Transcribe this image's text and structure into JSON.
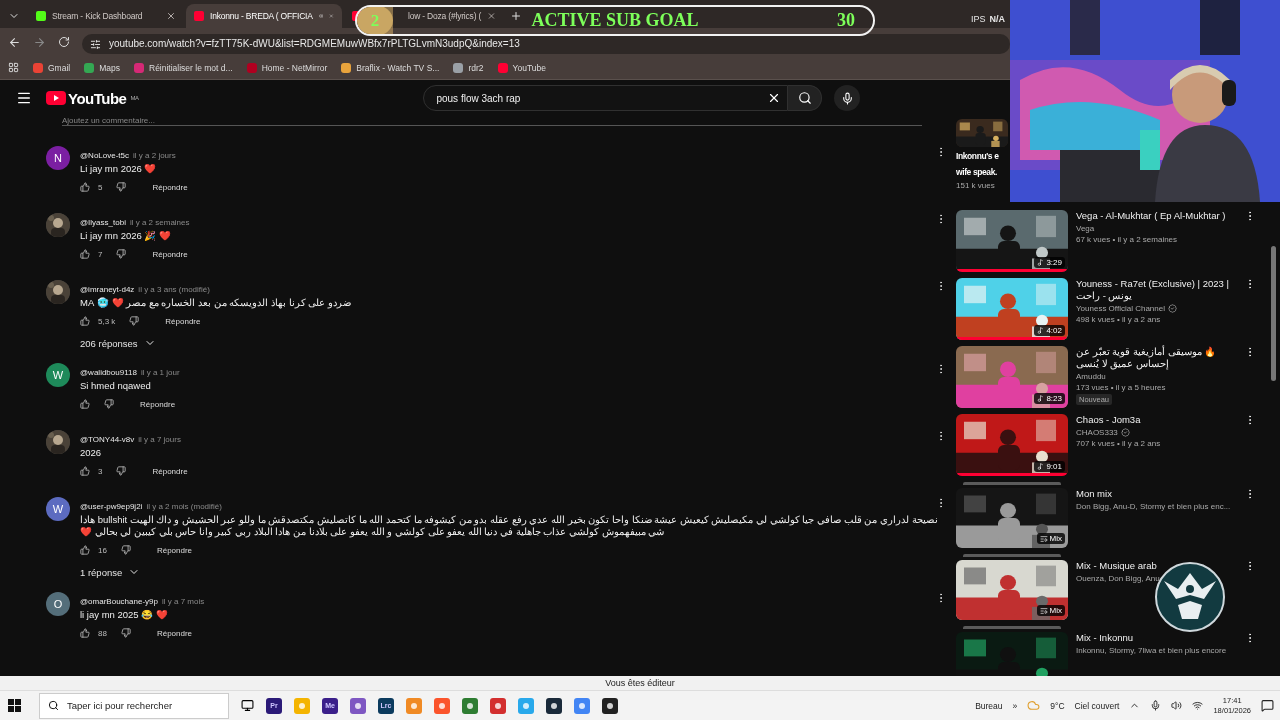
{
  "browser": {
    "tabs": [
      {
        "title": "Stream - Kick Dashboard",
        "selected": false,
        "audio": false,
        "color": "#53fc18"
      },
      {
        "title": "Inkonnu - BREDA ( OFFICIA",
        "selected": true,
        "audio": true,
        "color": "#ff0033"
      },
      {
        "title": "low - Doza (#lyrics) (",
        "selected": false,
        "audio": false,
        "color": "#ff0033"
      }
    ],
    "ips": {
      "label": "IPS",
      "value": "N/A"
    },
    "url": "youtube.com/watch?v=fzTT75K-dWU&list=RDGMEMuwWBfx7rPLTGLvmN3udpQ&index=13",
    "bookmarks": [
      {
        "label": "Gmail",
        "color": "#ea4335"
      },
      {
        "label": "Maps",
        "color": "#34a853"
      },
      {
        "label": "Réinitialiser le mot d...",
        "color": "#d62976"
      },
      {
        "label": "Home - NetMirror",
        "color": "#b00020"
      },
      {
        "label": "Braflix - Watch TV S...",
        "color": "#e8a33c"
      },
      {
        "label": "rdr2",
        "color": "#9aa0a6"
      },
      {
        "label": "YouTube",
        "color": "#ff0033"
      }
    ]
  },
  "sub_goal": {
    "current": "2",
    "title": "ACTIVE SUB GOAL",
    "target": "30",
    "level": 0.07
  },
  "youtube": {
    "logo": "YouTube",
    "region": "MA",
    "search": "pous flow 3ach rap"
  },
  "comment_box": {
    "placeholder": "Ajoutez un commentaire..."
  },
  "comments": [
    {
      "author": "@NoLove-t5c",
      "time": "il y a 2 jours",
      "text": "Li jay mn 2026 ❤️",
      "likes": "5",
      "reply": "Répondre",
      "avatar": {
        "kind": "letter",
        "letter": "N",
        "color": "#7b1fa2"
      }
    },
    {
      "author": "@Ilyass_tobi",
      "time": "il y a 2 semaines",
      "text": "Li jay mn 2026 🎉 ❤️",
      "likes": "7",
      "reply": "Répondre"
    },
    {
      "author": "@imraneyt-d4z",
      "time": "il y a 3 ans (modifié)",
      "text": "ضردو على كرنا بهاذ الدويسكه من بعد الخساره مع مصر ❤️ 🥶 MA",
      "likes": "5,3 k",
      "reply": "Répondre",
      "replies": "206 réponses"
    },
    {
      "author": "@walidbou9118",
      "time": "il y a 1 jour",
      "text": "Si hmed nqawed",
      "reply": "Répondre",
      "avatar": {
        "kind": "letter",
        "letter": "W",
        "color": "#1e8a5a"
      }
    },
    {
      "author": "@TONY44-v8v",
      "time": "il y a 7 jours",
      "text": "2026",
      "likes": "3",
      "reply": "Répondre"
    },
    {
      "author": "@user-pw9ep9j2i",
      "time": "il y a 2 mois (modifié)",
      "text": "نصيحة لدراري من قلب صافي جيا كولشي لي مكيصليش كيعيش عيشة ضنكا واحا تكون بخير الله عدي رفع عقله بدو من كيشوفه ما كتحمد الله ما كاتصليش مكتصدقش ما وللو عبر الحشيش و داك الهيت bullshit هادا شي مبيفهموش كولشي عذاب جاهلية في دنيا الله يعفو على كولشي و الله يعفو على بلادنا من هادا البلاد ربي كبير وانا حاس بلي كيبين لي بحالي ❤️",
      "likes": "16",
      "reply": "Répondre",
      "replies": "1 réponse",
      "avatar": {
        "kind": "letter",
        "letter": "W",
        "color": "#5c6bc0"
      }
    },
    {
      "author": "@omarBouchane-y9p",
      "time": "il y a 7 mois",
      "text": "li jay mn 2025 😂 ❤️",
      "likes": "88",
      "reply": "Répondre",
      "avatar": {
        "kind": "letter",
        "letter": "O",
        "color": "#546e7a"
      }
    }
  ],
  "related": [
    {
      "kind": "partial",
      "title_lines": [
        "Inkonnu's e",
        "wife speak."
      ],
      "meta": "151 k vues"
    },
    {
      "kind": "video",
      "title": "Vega - Al-Mukhtar ( Ep Al-Mukhtar )",
      "channel": "Vega",
      "verified": false,
      "meta": "67 k vues • il y a 2 semaines",
      "duration": "3:29",
      "watched": true
    },
    {
      "kind": "video",
      "title": "Youness  - Ra7et (Exclusive) | 2023 | يونس - راحت",
      "channel": "Youness Official Channel",
      "verified": true,
      "meta": "498 k vues • il y a 2 ans",
      "duration": "4:02",
      "watched": true
    },
    {
      "kind": "video",
      "title": "🔥 موسيقى أمازيغية قوية تعبّر عن إحساس عميق لا يُنسى",
      "channel": "Amuddu",
      "verified": false,
      "meta": "173 vues • il y a 5 heures",
      "duration": "8:23",
      "watched": false,
      "badge": "Nouveau"
    },
    {
      "kind": "video",
      "title": "Chaos - Jom3a",
      "channel": "CHAOS333",
      "verified": true,
      "meta": "707 k vues • il y a 2 ans",
      "duration": "9:01",
      "watched": true
    },
    {
      "kind": "mix",
      "title": "Mon mix",
      "channel": "Don Bigg, Anu-D, Stormy et bien plus enc...",
      "duration": "Mix"
    },
    {
      "kind": "mix",
      "title": "Mix - Musique arab",
      "channel": "Ouenza, Don Bigg, Anu",
      "duration": "Mix"
    },
    {
      "kind": "mix",
      "title": "Mix - Inkonnu",
      "channel": "Inkonnu, Stormy, 7liwa et bien plus encore"
    }
  ],
  "editor_bar": "Vous êtes éditeur",
  "taskbar": {
    "search": {
      "placeholder": "Taper ici pour rechercher"
    },
    "apps": [
      {
        "kind": "letter",
        "label": "Pr",
        "color": "#2b1a78"
      },
      {
        "kind": "tile",
        "color": "#f4b400"
      },
      {
        "kind": "letter",
        "label": "Me",
        "color": "#3b1f8a"
      },
      {
        "kind": "tile",
        "color": "#7e57c2"
      },
      {
        "kind": "letter",
        "label": "Lrc",
        "color": "#0c3b5e"
      },
      {
        "kind": "tile",
        "color": "#f08a24"
      },
      {
        "kind": "tile",
        "color": "#fb542b"
      },
      {
        "kind": "tile",
        "color": "#2e7d32"
      },
      {
        "kind": "tile",
        "color": "#d32f2f"
      },
      {
        "kind": "tile",
        "color": "#29a9eb"
      },
      {
        "kind": "tile",
        "color": "#1a2a3a"
      },
      {
        "kind": "tile",
        "color": "#4285f4"
      },
      {
        "kind": "tile",
        "color": "#222222"
      }
    ],
    "desktop": "Bureau",
    "more": "»",
    "temperature": "9°C",
    "weather": "Ciel couvert",
    "time": "17:41",
    "date": "18/01/2026"
  }
}
